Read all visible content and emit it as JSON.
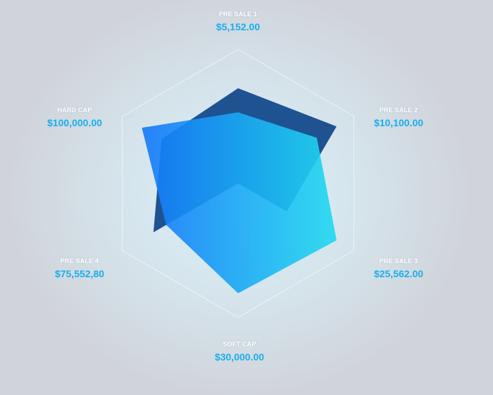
{
  "chart_data": {
    "type": "radar",
    "axes": [
      {
        "name": "PRE SALE 1",
        "value_label": "$5,152.00"
      },
      {
        "name": "PRE SALE 2",
        "value_label": "$10,100.00"
      },
      {
        "name": "PRE SALE 3",
        "value_label": "$25,562.00"
      },
      {
        "name": "SOFT CAP",
        "value_label": "$30,000.00"
      },
      {
        "name": "PRE SALE 4",
        "value_label": "$75,552,80"
      },
      {
        "name": "HARD CAP",
        "value_label": "$100,000.00"
      }
    ],
    "range": [
      0,
      1
    ],
    "series": [
      {
        "values": [
          0.71,
          0.85,
          0.42,
          0.0,
          0.73,
          0.66
        ],
        "color": "#1f5290"
      },
      {
        "values": [
          0.53,
          0.68,
          0.85,
          0.82,
          0.62,
          0.83
        ],
        "color_start": "#1477fa",
        "color_end": "#20daf0"
      }
    ],
    "grid": true,
    "grid_levels": [
      1.0
    ]
  }
}
